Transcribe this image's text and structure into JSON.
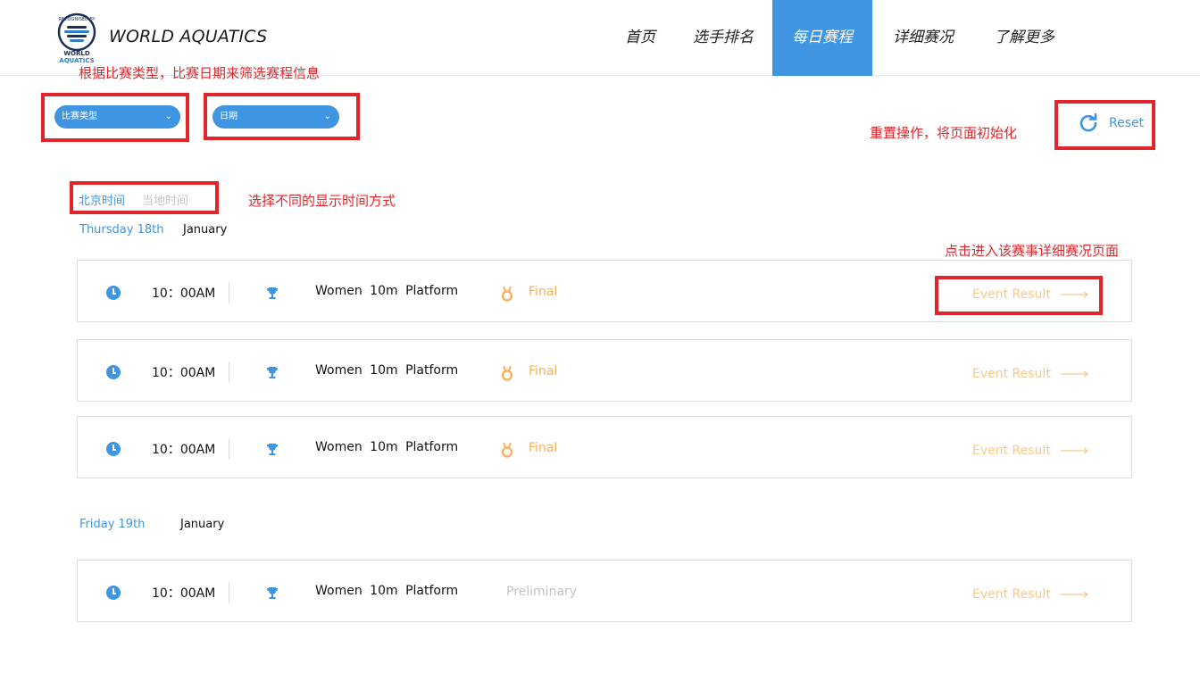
{
  "header": {
    "brand": "WORLD AQUATICS",
    "logo_text": [
      "RECOGNISED BY",
      "WORLD",
      "AQUATICS"
    ],
    "nav": [
      {
        "label": "首页",
        "active": false
      },
      {
        "label": "选手排名",
        "active": false
      },
      {
        "label": "每日赛程",
        "active": true
      },
      {
        "label": "详细赛况",
        "active": false
      },
      {
        "label": "了解更多",
        "active": false
      }
    ]
  },
  "filters": {
    "type_label": "比赛类型",
    "date_label": "日期",
    "reset_label": "Reset"
  },
  "time_toggle": {
    "beijing": "北京时间",
    "local": "当地时间",
    "active": "beijing"
  },
  "annotations": {
    "filter_note": "根据比赛类型，比赛日期来筛选赛程信息",
    "reset_note": "重置操作，将页面初始化",
    "time_note": "选择不同的显示时间方式",
    "result_note": "点击进入该赛事详细赛况页面"
  },
  "days": [
    {
      "day": "Thursday 18th",
      "month": "January",
      "events": [
        {
          "time": "10：00AM",
          "name": "Women 10m Platform",
          "stage": "Final",
          "result": "Event Result"
        },
        {
          "time": "10：00AM",
          "name": "Women 10m Platform",
          "stage": "Final",
          "result": "Event Result"
        },
        {
          "time": "10：00AM",
          "name": "Women 10m Platform",
          "stage": "Final",
          "result": "Event Result"
        }
      ]
    },
    {
      "day": "Friday 19th",
      "month": "January",
      "events": [
        {
          "time": "10：00AM",
          "name": "Women 10m Platform",
          "stage": "Preliminary",
          "result": "Event Result"
        }
      ]
    }
  ],
  "colors": {
    "accent": "#3f95e1",
    "annotation": "#e0262b",
    "final": "#f6b25a",
    "result": "#f8c98a",
    "prelim": "#c4c4c4"
  },
  "icons": {
    "clock": "clock-icon",
    "trophy": "trophy-icon",
    "medal": "medal-icon",
    "reset": "refresh-icon",
    "arrow": "long-arrow-right-icon",
    "chevron": "chevron-down-icon"
  }
}
